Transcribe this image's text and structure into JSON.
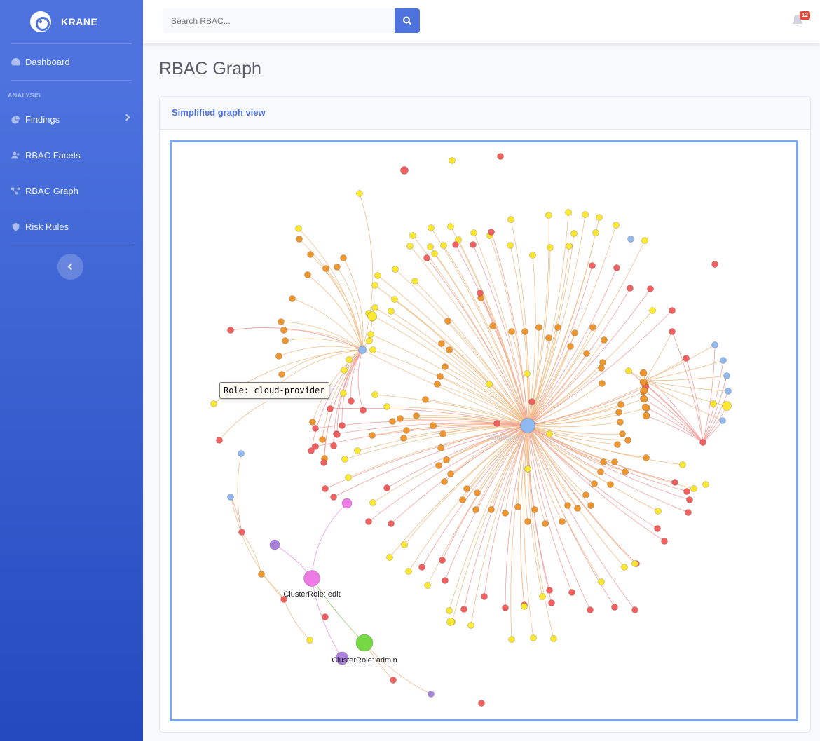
{
  "brand": {
    "name": "KRANE"
  },
  "sidebar": {
    "heading": "ANALYSIS",
    "items": [
      {
        "label": "Dashboard",
        "icon": "tachometer-icon"
      },
      {
        "label": "Findings",
        "icon": "chart-pie-icon"
      },
      {
        "label": "RBAC Facets",
        "icon": "users-icon"
      },
      {
        "label": "RBAC Graph",
        "icon": "project-diagram-icon"
      },
      {
        "label": "Risk Rules",
        "icon": "shield-icon"
      }
    ]
  },
  "topbar": {
    "search_placeholder": "Search RBAC...",
    "alerts_count": "12"
  },
  "main": {
    "title": "RBAC Graph",
    "card_title": "Simplified graph view"
  },
  "graph": {
    "tooltip": "Role: cloud-provider",
    "center_label": "Namespace",
    "labels": {
      "edit": "ClusterRole: edit",
      "admin": "ClusterRole: admin"
    },
    "colors": {
      "blue": "#8fb9f0",
      "orange": "#f0962e",
      "red": "#f26060",
      "yellow": "#fde831",
      "pink": "#ee7ae6",
      "purple": "#ab82dc",
      "green": "#77d846",
      "edge_orange": "#f2c08c",
      "edge_red": "#f4a0a0",
      "edge_pink": "#ec9ce4"
    }
  }
}
